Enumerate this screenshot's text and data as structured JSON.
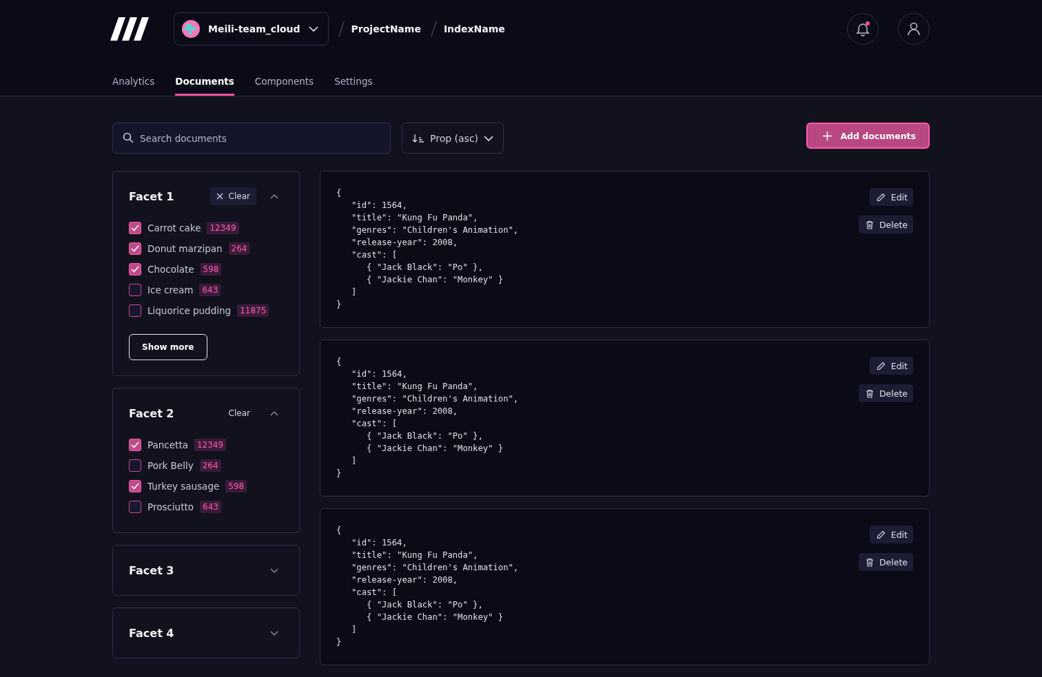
{
  "header": {
    "org": "Meili-team_cloud",
    "breadcrumb": [
      "ProjectName",
      "IndexName"
    ],
    "notification_unread": true
  },
  "tabs": [
    {
      "label": "Analytics",
      "selected": false
    },
    {
      "label": "Documents",
      "selected": true
    },
    {
      "label": "Components",
      "selected": false
    },
    {
      "label": "Settings",
      "selected": false
    }
  ],
  "toolbar": {
    "search": {
      "placeholder": "Search documents"
    },
    "sort": "Prop (asc)",
    "add_button": "Add documents"
  },
  "facets": [
    {
      "title": "Facet 1",
      "expanded": true,
      "clear": {
        "label": "Clear",
        "kind": "chip"
      },
      "show_more": "Show more",
      "options": [
        {
          "label": "Carrot cake",
          "count": "12349",
          "checked": true
        },
        {
          "label": "Donut marzipan",
          "count": "264",
          "checked": true
        },
        {
          "label": "Chocolate",
          "count": "598",
          "checked": true
        },
        {
          "label": "Ice cream",
          "count": "643",
          "checked": false
        },
        {
          "label": "Liquorice pudding",
          "count": "11875",
          "checked": false
        }
      ]
    },
    {
      "title": "Facet 2",
      "expanded": true,
      "clear": {
        "label": "Clear",
        "kind": "plain"
      },
      "options": [
        {
          "label": "Pancetta",
          "count": "12349",
          "checked": true
        },
        {
          "label": "Pork Belly",
          "count": "264",
          "checked": false
        },
        {
          "label": "Turkey sausage",
          "count": "598",
          "checked": true
        },
        {
          "label": "Prosciutto",
          "count": "643",
          "checked": false
        }
      ]
    },
    {
      "title": "Facet 3",
      "expanded": false
    },
    {
      "title": "Facet 4",
      "expanded": false
    }
  ],
  "documents": [
    {
      "code": "{\n   \"id\": 1564,\n   \"title\": \"Kung Fu Panda\",\n   \"genres\": \"Children's Animation\",\n   \"release-year\": 2008,\n   \"cast\": [\n      { \"Jack Black\": \"Po\" },\n      { \"Jackie Chan\": \"Monkey\" }\n   ]\n}",
      "edit": "Edit",
      "delete": "Delete"
    },
    {
      "code": "{\n   \"id\": 1564,\n   \"title\": \"Kung Fu Panda\",\n   \"genres\": \"Children's Animation\",\n   \"release-year\": 2008,\n   \"cast\": [\n      { \"Jack Black\": \"Po\" },\n      { \"Jackie Chan\": \"Monkey\" }\n   ]\n}",
      "edit": "Edit",
      "delete": "Delete"
    },
    {
      "code": "{\n   \"id\": 1564,\n   \"title\": \"Kung Fu Panda\",\n   \"genres\": \"Children's Animation\",\n   \"release-year\": 2008,\n   \"cast\": [\n      { \"Jack Black\": \"Po\" },\n      { \"Jackie Chan\": \"Monkey\" }\n   ]\n}",
      "edit": "Edit",
      "delete": "Delete"
    }
  ]
}
